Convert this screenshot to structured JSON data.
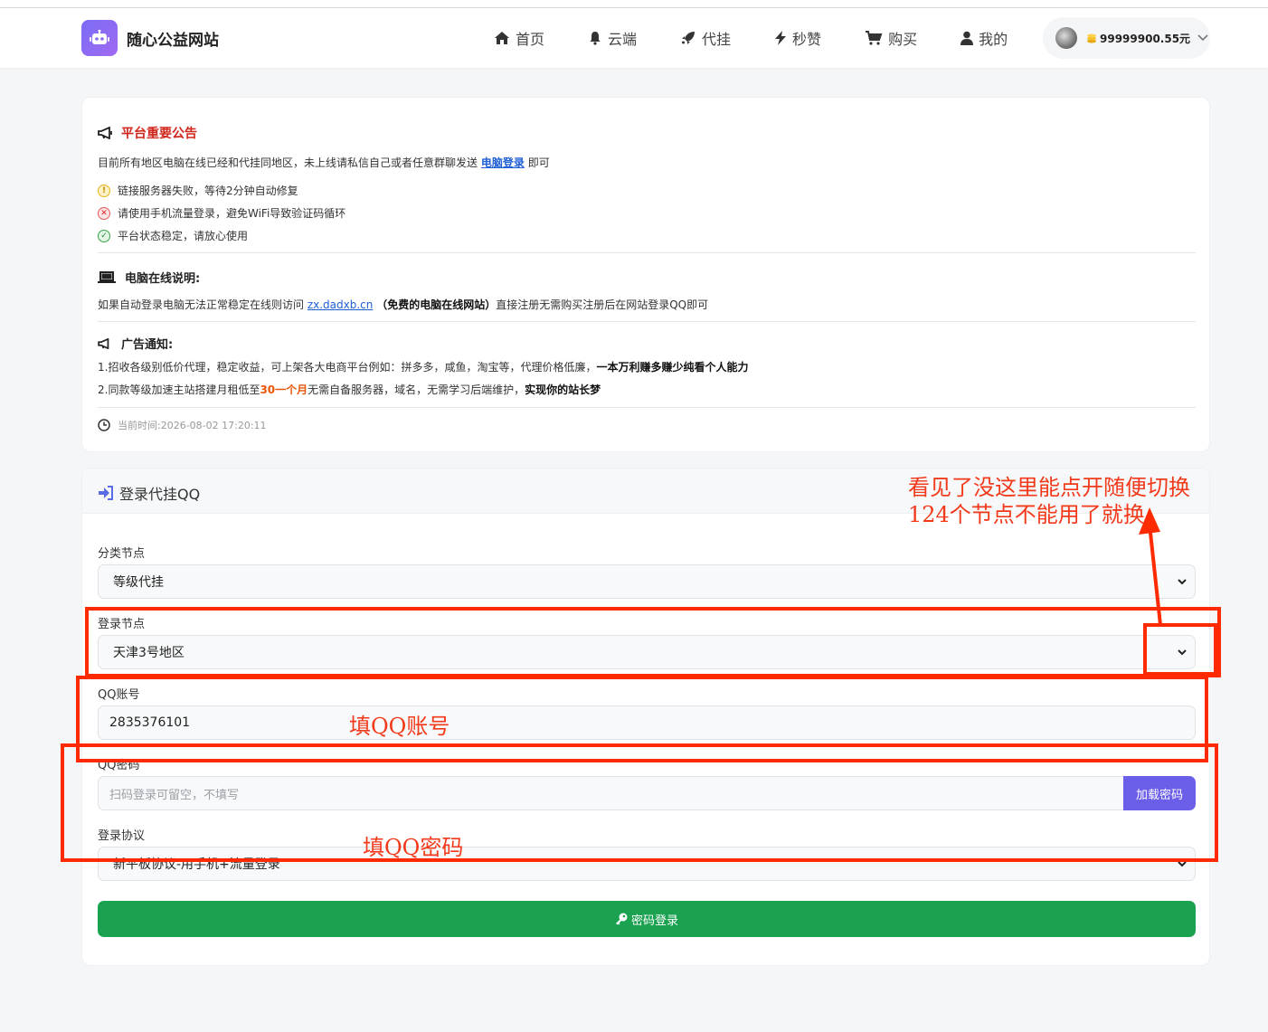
{
  "brand": {
    "name": "随心公益网站"
  },
  "nav": [
    {
      "label": "首页",
      "icon": "home-icon"
    },
    {
      "label": "云端",
      "icon": "bell-icon"
    },
    {
      "label": "代挂",
      "icon": "rocket-icon"
    },
    {
      "label": "秒赞",
      "icon": "bolt-icon"
    },
    {
      "label": "购买",
      "icon": "cart-icon"
    },
    {
      "label": "我的",
      "icon": "user-icon"
    }
  ],
  "user": {
    "balance": "99999900.55元"
  },
  "notice": {
    "title": "平台重要公告",
    "intro_pre": "目前所有地区电脑在线已经和代挂同地区，未上线请私信自己或者任意群聊发送",
    "intro_link": "电脑登录",
    "intro_post": "即可",
    "status": [
      {
        "type": "warn",
        "symbol": "!",
        "text": "链接服务器失败，等待2分钟自动修复"
      },
      {
        "type": "err",
        "symbol": "✕",
        "text": "请使用手机流量登录，避免WiFi导致验证码循环"
      },
      {
        "type": "ok",
        "symbol": "✓",
        "text": "平台状态稳定，请放心使用"
      }
    ],
    "pc_title": "电脑在线说明:",
    "pc_pre": "如果自动登录电脑无法正常稳定在线则访问",
    "pc_link": "zx.dadxb.cn",
    "pc_bold": "（免费的电脑在线网站）",
    "pc_post": "直接注册无需购买注册后在网站登录QQ即可",
    "ad_title": "广告通知:",
    "ad1_pre": "1.招收各级别低价代理，稳定收益，可上架各大电商平台例如：拼多多，咸鱼，淘宝等，代理价格低廉，",
    "ad1_bold": "一本万利赚多赚少纯看个人能力",
    "ad2_pre": "2.同款等级加速主站搭建月租低至",
    "ad2_hl": "30一个月",
    "ad2_mid": "无需自备服务器，域名，无需学习后端维护，",
    "ad2_bold": "实现你的站长梦",
    "time_label": "当前时间: ",
    "time_value": "2026-08-02 17:20:11"
  },
  "login": {
    "title": "登录代挂QQ",
    "category_label": "分类节点",
    "category_value": "等级代挂",
    "node_label": "登录节点",
    "node_value": "天津3号地区",
    "qq_label": "QQ账号",
    "qq_value": "2835376101",
    "pwd_label": "QQ密码",
    "pwd_placeholder": "扫码登录可留空，不填写",
    "pwd_button": "加载密码",
    "protocol_label": "登录协议",
    "protocol_value": "新平板协议-用手机+流量登录",
    "submit": "密码登录"
  },
  "annotations": {
    "switch_line1": "看见了没这里能点开随便切换",
    "switch_line2": "124个节点不能用了就换",
    "fill_qq": "填QQ账号",
    "fill_pwd": "填QQ密码"
  },
  "colors": {
    "accent": "#6b5ee8",
    "success": "#1aa250",
    "danger": "#d0271d",
    "annotation": "#ff2a00"
  }
}
